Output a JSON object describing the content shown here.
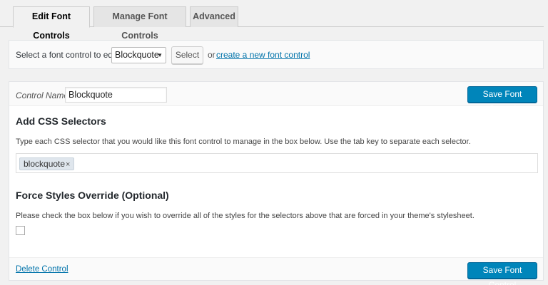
{
  "tabs": [
    {
      "label": "Edit Font Controls",
      "active": true
    },
    {
      "label": "Manage Font Controls",
      "active": false
    },
    {
      "label": "Advanced",
      "active": false
    }
  ],
  "select_control": {
    "prompt": "Select a font control to edit:",
    "selected_value": "Blockquote",
    "select_button": "Select",
    "or_text": "or",
    "create_link": "create a new font control"
  },
  "control": {
    "name_label": "Control Name",
    "name_value": "Blockquote",
    "save_button": "Save Font Control"
  },
  "css_selectors": {
    "title": "Add CSS Selectors",
    "description": "Type each CSS selector that you would like this font control to manage in the box below. Use the tab key to separate each selector.",
    "tags": [
      "blockquote"
    ],
    "tag_remove": "×"
  },
  "force_override": {
    "title": "Force Styles Override (Optional)",
    "description": "Please check the box below if you wish to override all of the styles for the selectors above that are forced in your theme's stylesheet.",
    "checked": false
  },
  "footer": {
    "delete_link": "Delete Control",
    "save_button": "Save Font Control"
  },
  "colors": {
    "primary": "#0085ba",
    "link": "#0073aa",
    "background": "#f1f1f1"
  },
  "icons": {
    "dropdown": "chevron-down-icon",
    "tag_remove": "close-icon"
  }
}
